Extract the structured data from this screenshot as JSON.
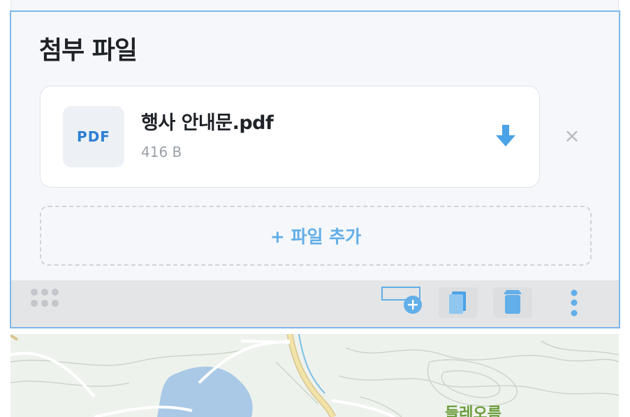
{
  "attachments": {
    "title": "첨부 파일",
    "files": [
      {
        "type_label": "PDF",
        "name": "행사 안내문.pdf",
        "size": "416 B",
        "download_icon": "download-arrow-icon",
        "remove_icon": "close-icon",
        "remove_label": "×"
      }
    ],
    "add_label": "+ 파일 추가"
  },
  "toolbar": {
    "icons": [
      "drag-handle-icon",
      "insert-block-icon",
      "copy-icon",
      "trash-icon",
      "more-vertical-icon"
    ]
  },
  "map": {
    "place_label": "들레오름"
  },
  "colors": {
    "accent": "#62aee9",
    "selection_border": "#7cb8ea",
    "pdf_label": "#2d7fd3",
    "map_label": "#6c9d3c"
  }
}
